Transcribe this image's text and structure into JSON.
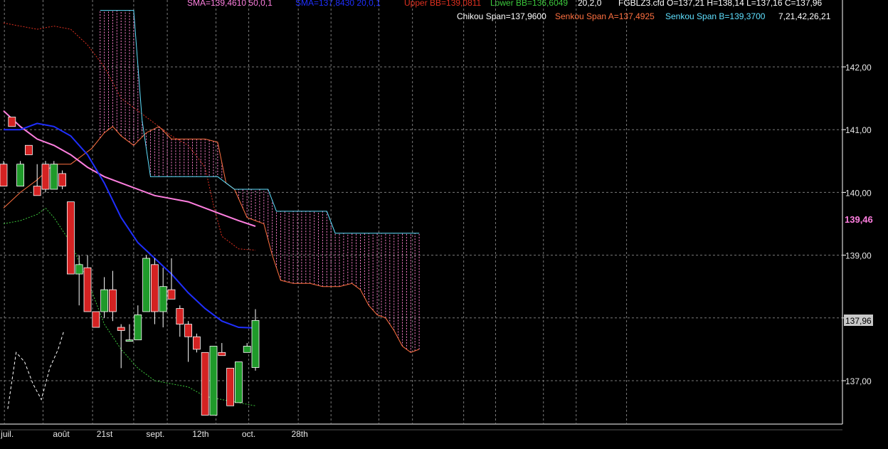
{
  "instrument": "FGBLZ3.cfd",
  "colors": {
    "background": "#000000",
    "grid": "#7a7a7a",
    "up_candle": "#1f9a2a",
    "down_candle": "#d42222",
    "sma50": "#ff7fe0",
    "sma20": "#1f2fff",
    "bb": "#e03020",
    "lower_bb": "#3cc83c",
    "kijun": "#ffffff",
    "senkou_a": "#ff7040",
    "senkou_b": "#5fe0ff",
    "cloud_hatch": "#ff80d0",
    "chikou": "#ffffff",
    "price_tag": "#c8c8c8"
  },
  "legend": {
    "row1": [
      {
        "text": "SMA=139,4610  50,0,1",
        "color": "#ff7fe0"
      },
      {
        "text": "SMA=137,8430  20,0,1",
        "color": "#1f2fff"
      },
      {
        "text": "Upper BB=139,0811",
        "color": "#e03020"
      },
      {
        "text": "Lower BB=136,6049",
        "color": "#3cc83c"
      },
      {
        "text": "20,2,0",
        "color": "#ffffff"
      },
      {
        "text": "FGBLZ3.cfd O=137,21 H=138,14 L=137,16 C=137,96",
        "color": "#ffffff"
      }
    ],
    "row2": [
      {
        "text": "Chikou Span=137,9600",
        "color": "#ffffff"
      },
      {
        "text": "Senkou Span A=137,4925",
        "color": "#ff7040"
      },
      {
        "text": "Senkou Span B=139,3700",
        "color": "#5fe0ff"
      },
      {
        "text": "7,21,42,26,21",
        "color": "#ffffff"
      }
    ]
  },
  "price_tags": {
    "sma50_value": "139,46",
    "last_close": "137,96"
  },
  "chart_data": {
    "type": "line",
    "description_series": "candlestick with SMA, Bollinger lower band, Ichimoku cloud",
    "y_ticks": [
      "137,00",
      "138,00",
      "139,00",
      "140,00",
      "141,00",
      "142,00"
    ],
    "ylim": [
      136.35,
      143.05
    ],
    "x_ticks": [
      {
        "label": "juil.",
        "i": 0.1
      },
      {
        "label": "août",
        "i": 6.3
      },
      {
        "label": "21st",
        "i": 11.5
      },
      {
        "label": "sept.",
        "i": 17.4
      },
      {
        "label": "12th",
        "i": 22.9
      },
      {
        "label": "oct.",
        "i": 28.8
      },
      {
        "label": "28th",
        "i": 34.7
      }
    ],
    "xlim": [
      -0.2,
      77
    ],
    "vgrid_i": [
      0.1,
      4.7,
      10.6,
      15.5,
      19.5,
      25.3,
      29.2,
      35.1,
      39.0,
      44.7,
      48.7,
      54.8,
      58.6,
      64.3,
      68.2,
      74.2
    ],
    "candles": [
      {
        "i": 0,
        "o": 140.45,
        "h": 140.5,
        "l": 140.1,
        "c": 140.1
      },
      {
        "i": 1,
        "o": 141.2,
        "h": 141.2,
        "l": 141.05,
        "c": 141.05
      },
      {
        "i": 2,
        "o": 140.1,
        "h": 140.5,
        "l": 140.1,
        "c": 140.45
      },
      {
        "i": 3,
        "o": 140.75,
        "h": 140.75,
        "l": 140.6,
        "c": 140.6
      },
      {
        "i": 4,
        "o": 140.1,
        "h": 140.45,
        "l": 139.95,
        "c": 139.95
      },
      {
        "i": 5,
        "o": 140.45,
        "h": 140.5,
        "l": 140.0,
        "c": 140.05
      },
      {
        "i": 6,
        "o": 140.05,
        "h": 140.5,
        "l": 140.05,
        "c": 140.45
      },
      {
        "i": 7,
        "o": 140.3,
        "h": 140.35,
        "l": 140.05,
        "c": 140.1
      },
      {
        "i": 8,
        "o": 139.85,
        "h": 139.85,
        "l": 138.7,
        "c": 138.7
      },
      {
        "i": 9,
        "o": 138.7,
        "h": 139.0,
        "l": 138.2,
        "c": 138.85
      },
      {
        "i": 10,
        "o": 138.8,
        "h": 139.0,
        "l": 138.1,
        "c": 138.1
      },
      {
        "i": 11,
        "o": 138.1,
        "h": 138.1,
        "l": 137.85,
        "c": 137.85
      },
      {
        "i": 12,
        "o": 138.1,
        "h": 138.65,
        "l": 138.0,
        "c": 138.45
      },
      {
        "i": 13,
        "o": 138.45,
        "h": 138.75,
        "l": 137.95,
        "c": 138.1
      },
      {
        "i": 14,
        "o": 137.85,
        "h": 137.9,
        "l": 137.2,
        "c": 137.8
      },
      {
        "i": 15,
        "o": 137.65,
        "h": 137.9,
        "l": 137.65,
        "c": 137.65
      },
      {
        "i": 16,
        "o": 137.65,
        "h": 138.2,
        "l": 137.65,
        "c": 138.05
      },
      {
        "i": 17,
        "o": 138.1,
        "h": 139.0,
        "l": 138.1,
        "c": 138.95
      },
      {
        "i": 18,
        "o": 138.85,
        "h": 138.95,
        "l": 137.9,
        "c": 138.1
      },
      {
        "i": 19,
        "o": 138.1,
        "h": 138.8,
        "l": 137.85,
        "c": 138.5
      },
      {
        "i": 20,
        "o": 138.45,
        "h": 138.95,
        "l": 138.3,
        "c": 138.3
      },
      {
        "i": 21,
        "o": 138.15,
        "h": 138.2,
        "l": 137.7,
        "c": 137.9
      },
      {
        "i": 22,
        "o": 137.9,
        "h": 137.95,
        "l": 137.3,
        "c": 137.7
      },
      {
        "i": 23,
        "o": 137.7,
        "h": 137.75,
        "l": 137.45,
        "c": 137.5
      },
      {
        "i": 24,
        "o": 137.45,
        "h": 137.45,
        "l": 136.45,
        "c": 136.45
      },
      {
        "i": 25,
        "o": 136.45,
        "h": 137.55,
        "l": 136.45,
        "c": 137.55
      },
      {
        "i": 26,
        "o": 137.45,
        "h": 137.6,
        "l": 137.4,
        "c": 137.4
      },
      {
        "i": 27,
        "o": 137.2,
        "h": 137.2,
        "l": 136.6,
        "c": 136.6
      },
      {
        "i": 28,
        "o": 136.65,
        "h": 137.3,
        "l": 136.65,
        "c": 137.3
      },
      {
        "i": 29,
        "o": 137.45,
        "h": 137.6,
        "l": 137.45,
        "c": 137.55
      },
      {
        "i": 30,
        "o": 137.21,
        "h": 138.14,
        "l": 137.16,
        "c": 137.96
      }
    ],
    "sma50": [
      [
        0,
        141.3
      ],
      [
        2,
        141.05
      ],
      [
        4,
        140.85
      ],
      [
        6,
        140.75
      ],
      [
        8,
        140.6
      ],
      [
        10,
        140.4
      ],
      [
        12,
        140.25
      ],
      [
        14,
        140.15
      ],
      [
        16,
        140.05
      ],
      [
        18,
        139.95
      ],
      [
        20,
        139.9
      ],
      [
        22,
        139.85
      ],
      [
        24,
        139.75
      ],
      [
        26,
        139.65
      ],
      [
        28,
        139.55
      ],
      [
        30,
        139.46
      ]
    ],
    "sma20": [
      [
        0,
        141.0
      ],
      [
        2,
        141.0
      ],
      [
        4,
        141.1
      ],
      [
        6,
        141.05
      ],
      [
        8,
        140.9
      ],
      [
        10,
        140.6
      ],
      [
        12,
        140.15
      ],
      [
        14,
        139.6
      ],
      [
        16,
        139.2
      ],
      [
        18,
        138.95
      ],
      [
        20,
        138.7
      ],
      [
        22,
        138.4
      ],
      [
        24,
        138.15
      ],
      [
        26,
        137.95
      ],
      [
        28,
        137.85
      ],
      [
        30,
        137.84
      ]
    ],
    "upper_bb": [
      [
        0,
        142.7
      ],
      [
        2,
        142.65
      ],
      [
        4,
        142.6
      ],
      [
        6,
        142.65
      ],
      [
        8,
        142.6
      ],
      [
        10,
        142.35
      ],
      [
        12,
        142.0
      ],
      [
        14,
        141.5
      ],
      [
        16,
        141.3
      ],
      [
        18,
        141.1
      ],
      [
        20,
        140.9
      ],
      [
        22,
        140.75
      ],
      [
        24,
        140.4
      ],
      [
        25,
        139.8
      ],
      [
        26,
        139.3
      ],
      [
        28,
        139.1
      ],
      [
        30,
        139.08
      ]
    ],
    "lower_bb": [
      [
        0,
        139.5
      ],
      [
        2,
        139.55
      ],
      [
        4,
        139.65
      ],
      [
        5,
        139.75
      ],
      [
        6,
        139.6
      ],
      [
        8,
        139.2
      ],
      [
        10,
        138.6
      ],
      [
        12,
        137.9
      ],
      [
        14,
        137.5
      ],
      [
        16,
        137.2
      ],
      [
        18,
        137.0
      ],
      [
        20,
        136.95
      ],
      [
        22,
        136.9
      ],
      [
        24,
        136.75
      ],
      [
        26,
        136.7
      ],
      [
        28,
        136.65
      ],
      [
        30,
        136.6
      ]
    ],
    "kijun_white": [
      [
        0.5,
        136.55
      ],
      [
        1.5,
        137.45
      ],
      [
        2.5,
        137.3
      ],
      [
        3.5,
        136.95
      ],
      [
        4.5,
        136.7
      ],
      [
        5.5,
        137.2
      ],
      [
        6.5,
        137.5
      ],
      [
        7.2,
        137.8
      ]
    ],
    "senkou_a": [
      [
        0,
        139.75
      ],
      [
        2,
        140.0
      ],
      [
        4,
        140.2
      ],
      [
        6,
        140.45
      ],
      [
        8,
        140.45
      ],
      [
        9.5,
        140.6
      ],
      [
        10.5,
        140.7
      ],
      [
        12,
        140.95
      ],
      [
        13,
        141.05
      ],
      [
        14,
        140.9
      ],
      [
        15.5,
        140.75
      ],
      [
        17,
        140.95
      ],
      [
        18.5,
        141.05
      ],
      [
        20,
        140.85
      ],
      [
        22,
        140.85
      ],
      [
        24,
        140.85
      ],
      [
        25.5,
        140.8
      ],
      [
        26.5,
        140.15
      ],
      [
        27.5,
        140.05
      ],
      [
        29,
        139.6
      ],
      [
        31,
        139.5
      ],
      [
        32,
        139.0
      ],
      [
        33,
        138.6
      ],
      [
        34.5,
        138.55
      ],
      [
        36.5,
        138.55
      ],
      [
        38,
        138.5
      ],
      [
        40,
        138.5
      ],
      [
        41.5,
        138.55
      ],
      [
        42.5,
        138.45
      ],
      [
        43.5,
        138.2
      ],
      [
        44.5,
        138.05
      ],
      [
        45.5,
        138.0
      ],
      [
        46.5,
        137.8
      ],
      [
        47.5,
        137.55
      ],
      [
        48.5,
        137.45
      ],
      [
        49.5,
        137.5
      ]
    ],
    "senkou_b": [
      [
        11.5,
        142.9
      ],
      [
        15.5,
        142.9
      ],
      [
        16.5,
        141.15
      ],
      [
        17.5,
        140.25
      ],
      [
        25.5,
        140.25
      ],
      [
        26.5,
        140.15
      ],
      [
        27.5,
        140.05
      ],
      [
        31.5,
        140.05
      ],
      [
        32.5,
        139.7
      ],
      [
        38.5,
        139.7
      ],
      [
        39.5,
        139.35
      ],
      [
        49.5,
        139.35
      ]
    ]
  }
}
